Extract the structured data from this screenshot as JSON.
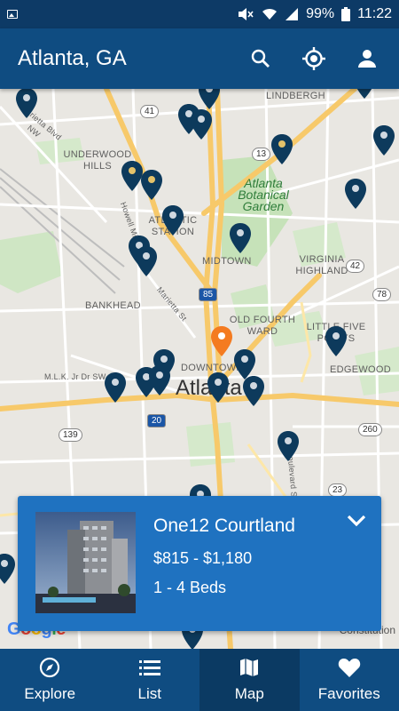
{
  "status_bar": {
    "battery": "99%",
    "time": "11:22"
  },
  "app_bar": {
    "title": "Atlanta, GA",
    "icons": [
      "search-icon",
      "my-location-icon",
      "account-icon"
    ]
  },
  "map": {
    "labels": {
      "lindbergh": "LINDBERGH",
      "marietta": "Marietta Blvd NW",
      "underwood": "UNDERWOOD HILLS",
      "botanical": "Atlanta Botanical Garden",
      "atlantic": "ATLANTIC STATION",
      "midtown": "MIDTOWN",
      "virginia": "VIRGINIA HIGHLAND",
      "bankhead": "BANKHEAD",
      "marietta_st": "Marietta St",
      "old_fourth": "OLD FOURTH WARD",
      "little_five": "LITTLE FIVE POINTS",
      "edgewood": "EDGEWOOD",
      "mlk": "M.L.K. Jr Dr SW",
      "downtown": "DOWNTOWN",
      "city": "Atlanta",
      "howell": "Howell Mill Rd",
      "boulevard": "Boulevard SE"
    },
    "shields": {
      "r41": "41",
      "r13": "13",
      "i85": "85",
      "r42": "42",
      "r78": "78",
      "i20": "20",
      "r139": "139",
      "r260": "260",
      "r23": "23"
    },
    "google": "Google",
    "credit": "Constitution"
  },
  "property_card": {
    "name": "One12 Courtland",
    "price": "$815 - $1,180",
    "beds": "1 - 4 Beds"
  },
  "bottom_nav": {
    "explore": "Explore",
    "list": "List",
    "map": "Map",
    "favorites": "Favorites"
  },
  "colors": {
    "primary": "#0f4c81",
    "card": "#1f72c0",
    "pin": "#0d3a5c",
    "pin_selected": "#f47b20",
    "highway": "#f7c96a"
  }
}
